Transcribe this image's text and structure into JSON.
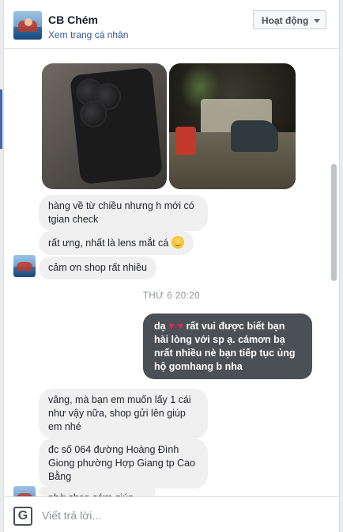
{
  "header": {
    "name": "CB Chém",
    "profile_link": "Xem trang cá nhân",
    "status": "Hoạt động"
  },
  "messages": {
    "m1": "hàng về từ chiều nhưng h mới có tgian check",
    "m2": "rất ưng, nhất là lens mắt cá",
    "m3": "cảm ơn shop rất nhiều",
    "timestamp": "THỨ 6 20:20",
    "m4_a": "dạ",
    "m4_b": "rất vui được biết bạn hài lòng với sp ạ. cámơn bạ nrất nhiều nè bạn tiếp tục ủng hộ gomhang  b nha",
    "m5": "vâng, mà bạn em muốn lấy 1 cái như vậy nữa, shop gửi lên giúp em nhé",
    "m6": "đc số 064 đường Hoàng Đình Giong phường Hợp Giang tp Cao Bằng",
    "m7": "nhờ shop sớm giúp em cho"
  },
  "composer": {
    "icon_letter": "G",
    "placeholder": "Viết trả lời..."
  },
  "icons": [
    "avatar",
    "heart-icon",
    "smile-emoji-icon",
    "grammarly-icon",
    "chevron-down-icon"
  ],
  "colors": {
    "accent": "#4267b2",
    "outgoing_bubble": "#4b4f56",
    "incoming_bubble": "#f1f0f0",
    "link": "#365899",
    "heart": "#e0245e"
  }
}
